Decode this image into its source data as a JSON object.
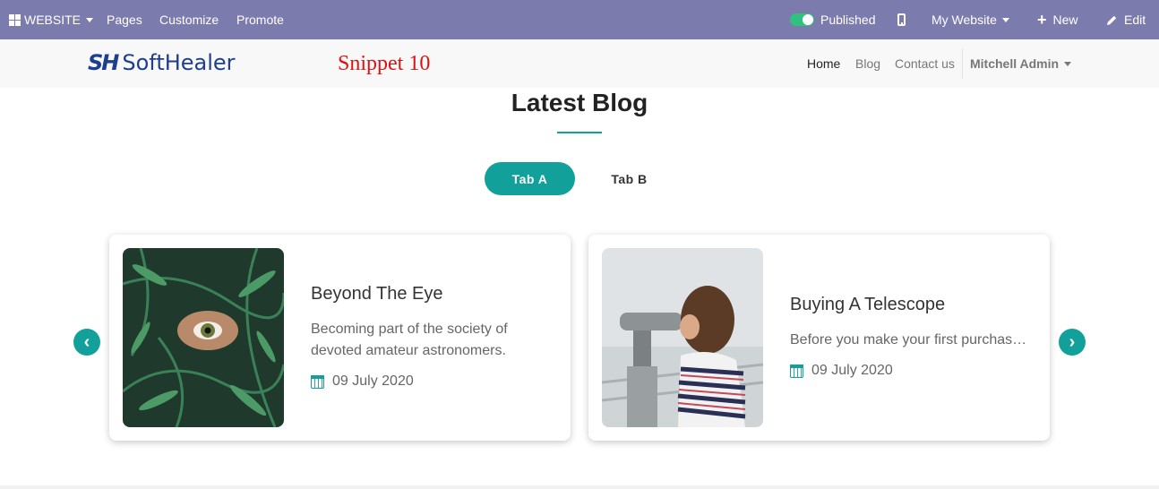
{
  "adminbar": {
    "website_label": "WEBSITE",
    "pages_label": "Pages",
    "customize_label": "Customize",
    "promote_label": "Promote",
    "published_label": "Published",
    "my_website_label": "My Website",
    "new_label": "New",
    "edit_label": "Edit",
    "bg_color": "#7c7bad"
  },
  "header": {
    "logo_mark": "SH",
    "logo_text": "SoftHealer",
    "snippet_label": "Snippet 10",
    "nav": {
      "home": "Home",
      "blog": "Blog",
      "contact": "Contact us",
      "user": "Mitchell Admin"
    }
  },
  "section": {
    "title": "Latest Blog",
    "tabs": [
      {
        "label": "Tab A",
        "active": true
      },
      {
        "label": "Tab B",
        "active": false
      }
    ],
    "accent_color": "#12a19a"
  },
  "posts": [
    {
      "title": "Beyond The Eye",
      "description": "Becoming part of the society of devoted amateur astronomers.",
      "date": "09 July 2020",
      "image": "fern-eye-photo"
    },
    {
      "title": "Buying A Telescope",
      "description": "Before you make your first purchase, …",
      "date": "09 July 2020",
      "image": "telescope-photo"
    }
  ],
  "carousel": {
    "prev_icon": "‹",
    "next_icon": "›"
  }
}
